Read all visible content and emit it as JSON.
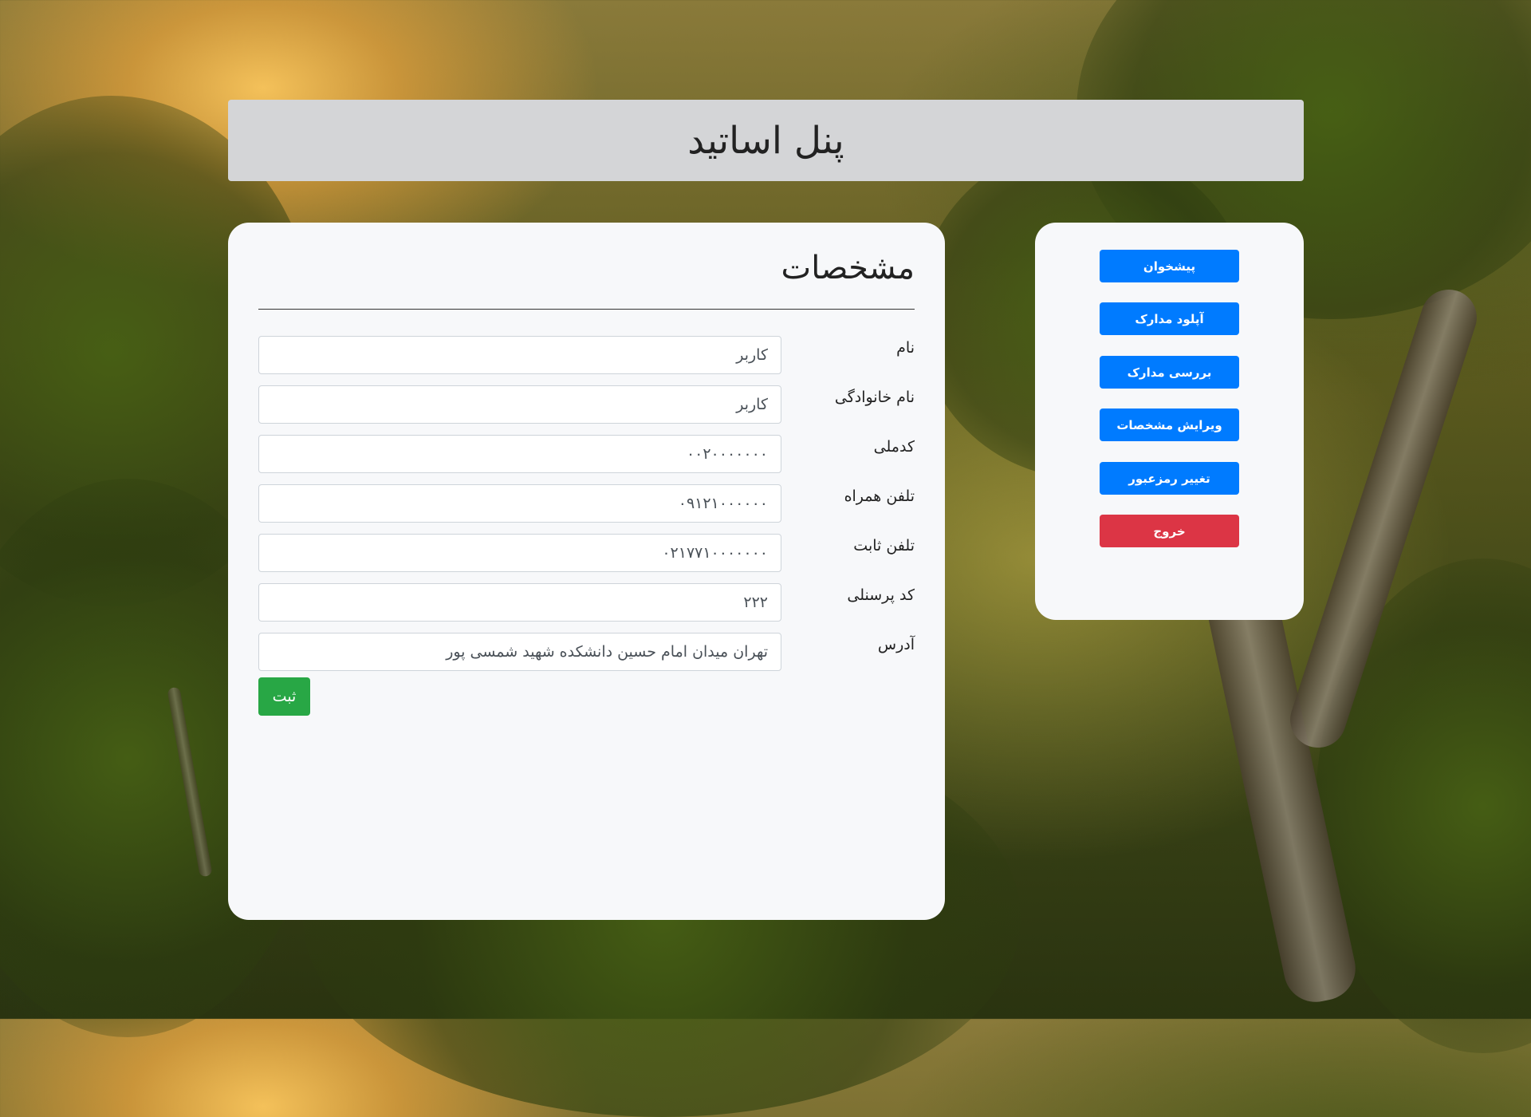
{
  "header": {
    "title": "پنل اساتید"
  },
  "main": {
    "title": "مشخصات",
    "fields": [
      {
        "label": "نام",
        "value": "کاربر"
      },
      {
        "label": "نام خانوادگی",
        "value": "کاربر"
      },
      {
        "label": "کدملی",
        "value": "۰۰۲۰۰۰۰۰۰۰"
      },
      {
        "label": "تلفن همراه",
        "value": "۰۹۱۲۱۰۰۰۰۰۰"
      },
      {
        "label": "تلفن ثابت",
        "value": "۰۲۱۷۷۱۰۰۰۰۰۰۰"
      },
      {
        "label": "کد پرسنلی",
        "value": "۲۲۲"
      },
      {
        "label": "آدرس",
        "value": "تهران میدان امام حسین دانشکده شهید شمسی پور"
      }
    ],
    "submit_label": "ثبت"
  },
  "sidebar": {
    "buttons": [
      {
        "label": "پیشخوان"
      },
      {
        "label": "آپلود مدارک"
      },
      {
        "label": "بررسی مدارک"
      },
      {
        "label": "ویرایش مشخصات"
      },
      {
        "label": "تغییر رمزعبور"
      },
      {
        "label": "خروج"
      }
    ]
  },
  "colors": {
    "primary": "#007bff",
    "danger": "#dc3545",
    "success": "#28a745",
    "header_bg": "#d4d5d7",
    "card_bg": "#f7f8fa"
  }
}
